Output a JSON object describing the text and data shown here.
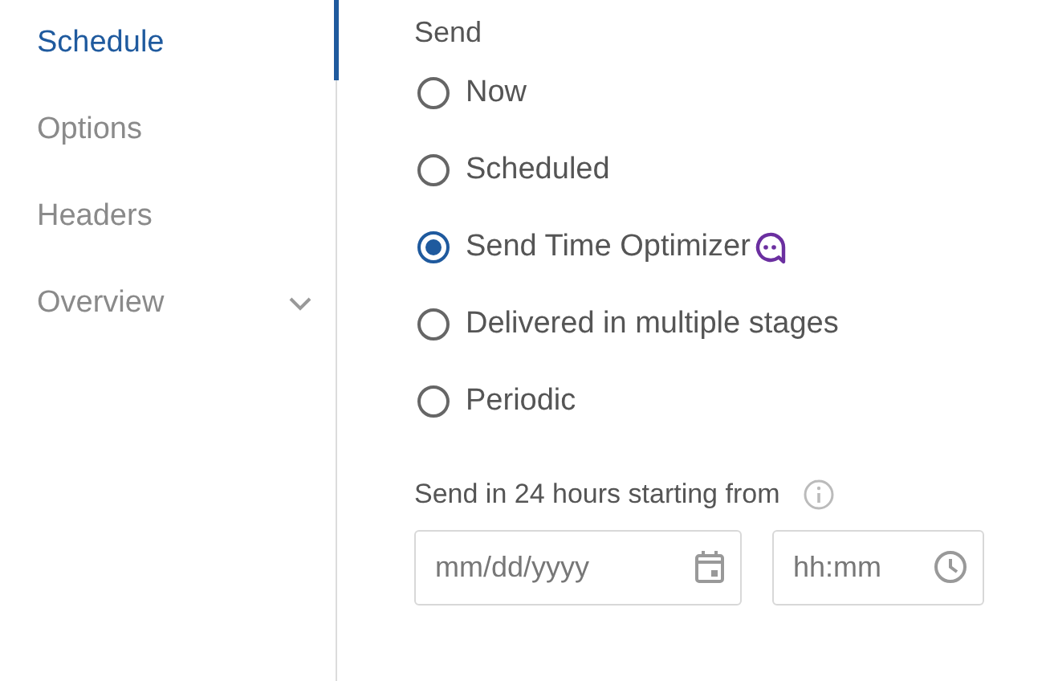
{
  "sidebar": {
    "items": [
      {
        "label": "Schedule",
        "selected": true,
        "expandable": false
      },
      {
        "label": "Options",
        "selected": false,
        "expandable": false
      },
      {
        "label": "Headers",
        "selected": false,
        "expandable": false
      },
      {
        "label": "Overview",
        "selected": false,
        "expandable": true
      }
    ]
  },
  "send": {
    "title": "Send",
    "options": [
      {
        "label": "Now",
        "selected": false,
        "badge": false
      },
      {
        "label": "Scheduled",
        "selected": false,
        "badge": false
      },
      {
        "label": "Send Time Optimizer",
        "selected": true,
        "badge": true
      },
      {
        "label": "Delivered in multiple stages",
        "selected": false,
        "badge": false
      },
      {
        "label": "Periodic",
        "selected": false,
        "badge": false
      }
    ]
  },
  "start": {
    "label": "Send in 24 hours starting from",
    "date": {
      "placeholder": "mm/dd/yyyy"
    },
    "time": {
      "placeholder": "hh:mm"
    }
  }
}
